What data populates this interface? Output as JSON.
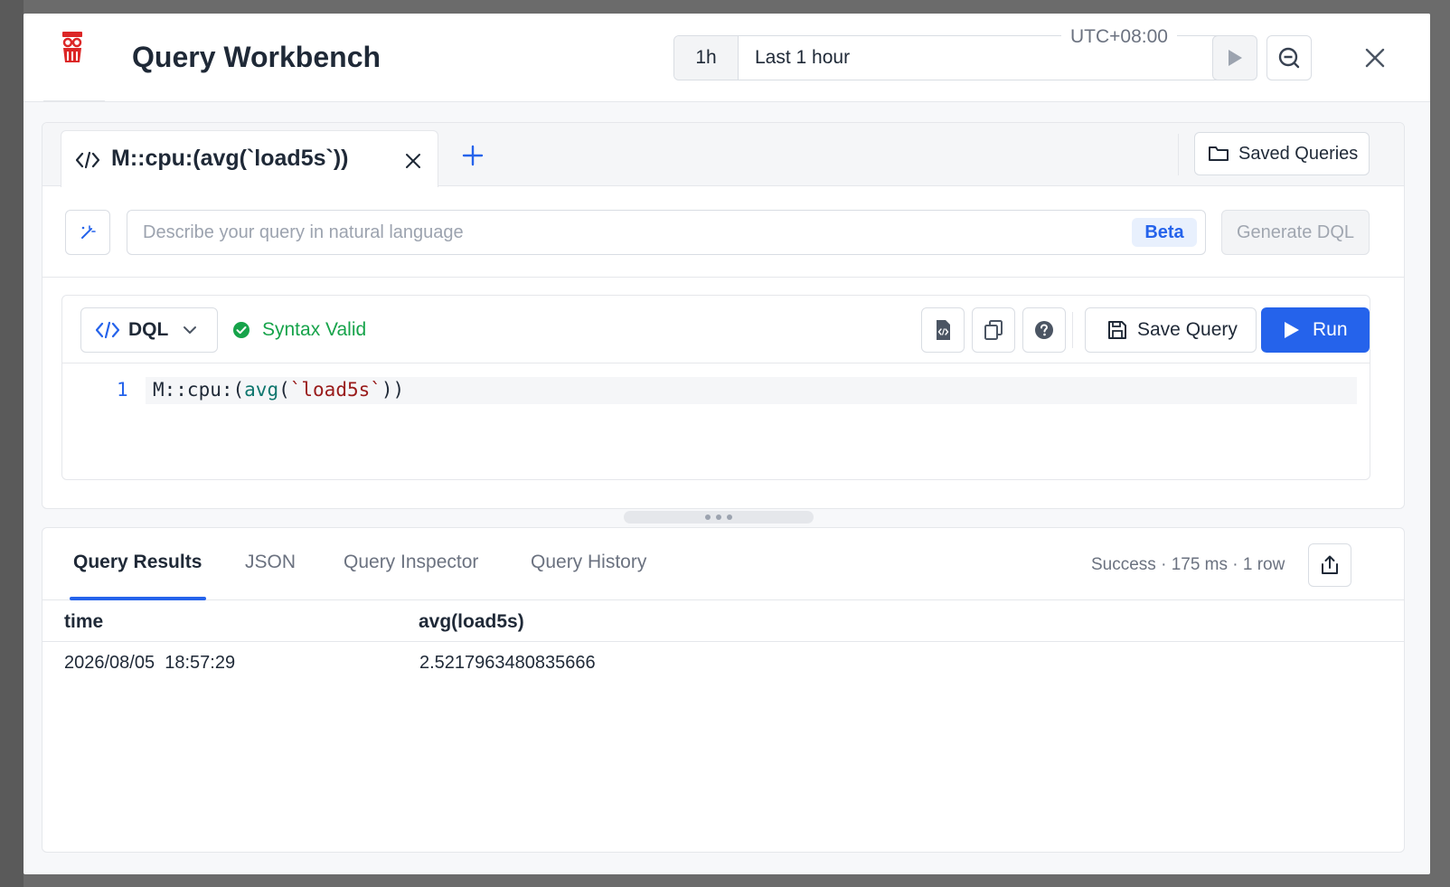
{
  "header": {
    "title": "Query Workbench",
    "time_range_short": "1h",
    "time_range_label": "Last 1 hour",
    "timezone": "UTC+08:00"
  },
  "query_tabs": [
    {
      "label": "M::cpu:(avg(`load5s`))"
    }
  ],
  "saved_queries_label": "Saved Queries",
  "natural_language": {
    "placeholder": "Describe your query in natural language",
    "beta_badge": "Beta",
    "generate_label": "Generate DQL"
  },
  "editor": {
    "language": "DQL",
    "syntax_status": "Syntax Valid",
    "save_label": "Save Query",
    "run_label": "Run",
    "lines": [
      {
        "number": "1",
        "tokens": [
          "M::cpu:(",
          "avg",
          "(",
          "`load5s`",
          "))"
        ]
      }
    ]
  },
  "results": {
    "tabs": [
      "Query Results",
      "JSON",
      "Query Inspector",
      "Query History"
    ],
    "active_tab": "Query Results",
    "status": "Success · 175 ms · 1 row",
    "columns": [
      "time",
      "avg(load5s)"
    ],
    "rows": [
      [
        "2026/08/05  18:57:29",
        "2.5217963480835666"
      ]
    ]
  },
  "colors": {
    "accent": "#2563eb",
    "success": "#16a34a",
    "brand": "#dc2626"
  },
  "icons": {
    "logo": "owl-logo-icon",
    "run_time": "play-icon",
    "zoom_out": "zoom-out-icon",
    "close": "close-icon",
    "code": "code-icon",
    "add": "plus-icon",
    "folder": "folder-icon",
    "wand": "magic-wand-icon",
    "check": "check-circle-icon",
    "format": "format-file-icon",
    "copy": "copy-icon",
    "help": "help-icon",
    "save": "save-icon",
    "export": "share-icon"
  }
}
